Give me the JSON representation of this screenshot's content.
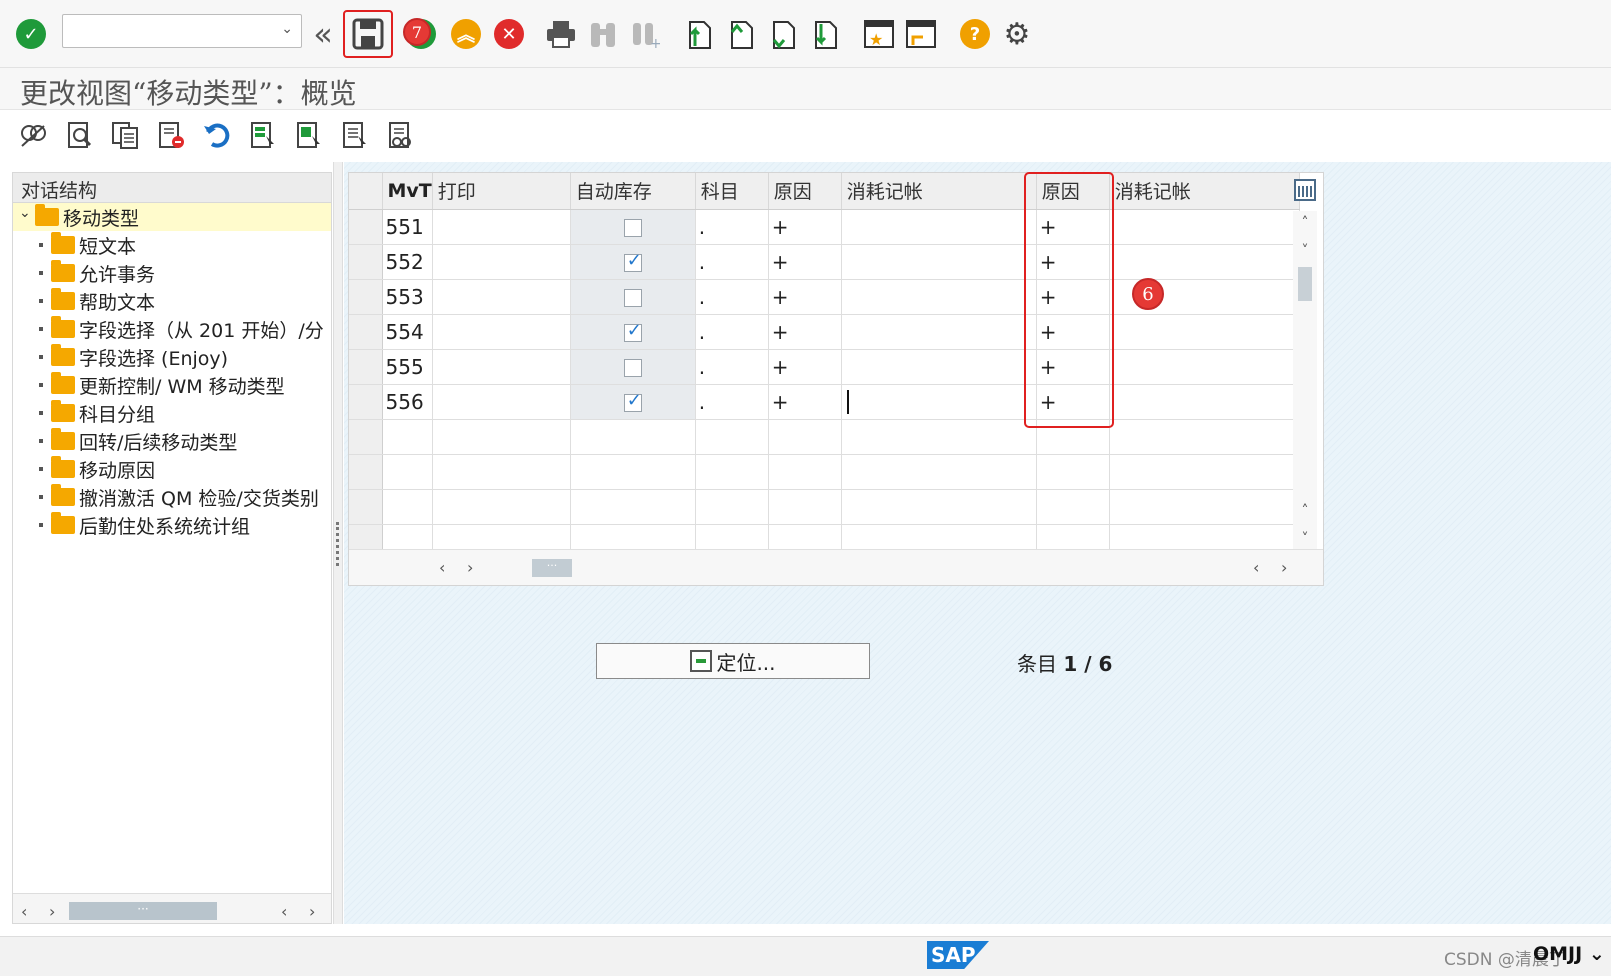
{
  "toolbar": {
    "command_field_value": "",
    "icons": [
      "check-icon",
      "back-double-chevron-icon",
      "save-icon",
      "back-icon",
      "exit-icon",
      "cancel-icon",
      "print-icon",
      "find-icon",
      "find-next-icon",
      "first-page-icon",
      "previous-page-icon",
      "next-page-icon",
      "last-page-icon",
      "new-session-icon",
      "shortcut-icon",
      "help-icon",
      "settings-icon"
    ],
    "marker_7": "7"
  },
  "page_title": "更改视图“移动类型”：概览",
  "app_toolbar": {
    "icons": [
      "display-change-icon",
      "find-record-icon",
      "copy-entries-icon",
      "delete-entries-icon",
      "undo-icon",
      "select-all-icon",
      "select-block-icon",
      "deselect-all-icon",
      "print-field-list-icon"
    ]
  },
  "tree": {
    "header": "对话结构",
    "root": "移动类型",
    "items": [
      "短文本",
      "允许事务",
      "帮助文本",
      "字段选择（从 201 开始）/分",
      "字段选择 (Enjoy)",
      "更新控制/ WM 移动类型",
      "科目分组",
      "回转/后续移动类型",
      "移动原因",
      "撤消激活 QM 检验/交货类别",
      "后勤住处系统统计组"
    ]
  },
  "grid": {
    "columns": [
      "MvT",
      "打印",
      "自动库存",
      "科目",
      "原因",
      "消耗记帐",
      "原因",
      "消耗记帐"
    ],
    "rows": [
      {
        "mvt": "551",
        "print": "",
        "auto": false,
        "account": ".",
        "reason": "+",
        "consume": "",
        "reason2": "+",
        "consume2": ""
      },
      {
        "mvt": "552",
        "print": "",
        "auto": true,
        "account": ".",
        "reason": "+",
        "consume": "",
        "reason2": "+",
        "consume2": ""
      },
      {
        "mvt": "553",
        "print": "",
        "auto": false,
        "account": ".",
        "reason": "+",
        "consume": "",
        "reason2": "+",
        "consume2": ""
      },
      {
        "mvt": "554",
        "print": "",
        "auto": true,
        "account": ".",
        "reason": "+",
        "consume": "",
        "reason2": "+",
        "consume2": ""
      },
      {
        "mvt": "555",
        "print": "",
        "auto": false,
        "account": ".",
        "reason": "+",
        "consume": "",
        "reason2": "+",
        "consume2": ""
      },
      {
        "mvt": "556",
        "print": "",
        "auto": true,
        "account": ".",
        "reason": "+",
        "consume": "",
        "reason2": "+",
        "consume2": ""
      }
    ],
    "empty_rows": 4,
    "marker_6": "6"
  },
  "position_button": "定位...",
  "entry_label": "条目",
  "entry_value": "1 / 6",
  "status": {
    "sap_logo": "SAP",
    "watermark": "CSDN @清晨丁",
    "system": "OMJJ"
  },
  "colors": {
    "accent_red": "#e02020",
    "check_green": "#1f9a3a",
    "cancel_red": "#e02b2b",
    "exit_orange": "#f0a000",
    "folder": "#f5a800",
    "sap_blue": "#1a7dd4"
  }
}
